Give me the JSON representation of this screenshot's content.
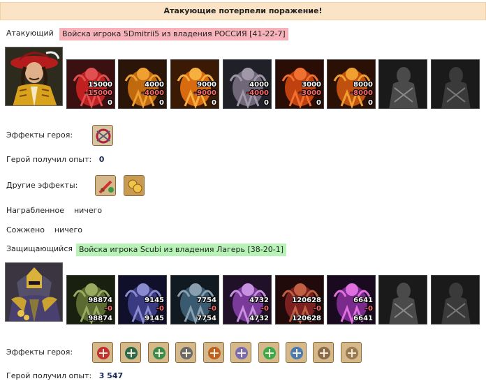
{
  "battle": {
    "result": "Атакующие потерпели поражение!"
  },
  "attacker": {
    "label": "Атакующий",
    "title": "Войска игрока 5Dmitrii5 из владения РОССИЯ [41-22-7]",
    "units": [
      {
        "count": "15000",
        "loss": "-15000",
        "left": "0",
        "icon": "red-dragon-icon"
      },
      {
        "count": "4000",
        "loss": "-4000",
        "left": "0",
        "icon": "fire-skeleton-icon"
      },
      {
        "count": "9000",
        "loss": "-9000",
        "left": "0",
        "icon": "fire-beast-icon"
      },
      {
        "count": "4000",
        "loss": "-4000",
        "left": "0",
        "icon": "bone-dragon-icon"
      },
      {
        "count": "3000",
        "loss": "-3000",
        "left": "0",
        "icon": "fire-elemental-icon"
      },
      {
        "count": "8000",
        "loss": "-8000",
        "left": "0",
        "icon": "fire-demon-icon"
      },
      {
        "count": "",
        "loss": "",
        "left": "",
        "icon": "empty-slot-icon"
      },
      {
        "count": "",
        "loss": "",
        "left": "",
        "icon": "empty-slot-icon"
      }
    ],
    "hero_effects_label": "Эффекты героя:",
    "hero_effects": [
      "blade-swirl-icon"
    ],
    "exp_label": "Герой получил опыт:",
    "exp_value": "0",
    "other_effects_label": "Другие эффекты:",
    "other_effects": [
      "sword-icon",
      "coins-icon"
    ],
    "loot_label": "Награбленное",
    "loot_value": "ничего",
    "burned_label": "Сожжено",
    "burned_value": "ничего"
  },
  "defender": {
    "label": "Защищающийся",
    "title": "Войска игрока Scubi из владения Лагерь [38-20-1]",
    "units": [
      {
        "count": "98874",
        "loss": "-0",
        "left": "98874",
        "icon": "ogre-icon"
      },
      {
        "count": "9145",
        "loss": "-0",
        "left": "9145",
        "icon": "dark-knight-icon"
      },
      {
        "count": "7754",
        "loss": "-0",
        "left": "7754",
        "icon": "lizard-warrior-icon"
      },
      {
        "count": "4732",
        "loss": "-0",
        "left": "4732",
        "icon": "harpy-icon"
      },
      {
        "count": "120628",
        "loss": "-0",
        "left": "120628",
        "icon": "archer-icon"
      },
      {
        "count": "6641",
        "loss": "-0",
        "left": "6641",
        "icon": "sorcerer-icon"
      },
      {
        "count": "",
        "loss": "",
        "left": "",
        "icon": "empty-slot-icon"
      },
      {
        "count": "",
        "loss": "",
        "left": "",
        "icon": "empty-slot-icon"
      }
    ],
    "hero_effects_label": "Эффекты героя:",
    "hero_effects": [
      "dice-icon",
      "shield-icon",
      "fist-shield-icon",
      "amulet-icon",
      "beetle-icon",
      "spiral-icon",
      "clover-icon",
      "spear-icon",
      "round-shield-icon",
      "skeleton-icon"
    ],
    "exp_label": "Герой получил опыт:",
    "exp_value": "3 547"
  },
  "colors": {
    "banner": "#fbe3c5",
    "attacker_title": "#f7b3b9",
    "defender_title": "#b7f3b6",
    "loss": "#ff6a6a"
  }
}
